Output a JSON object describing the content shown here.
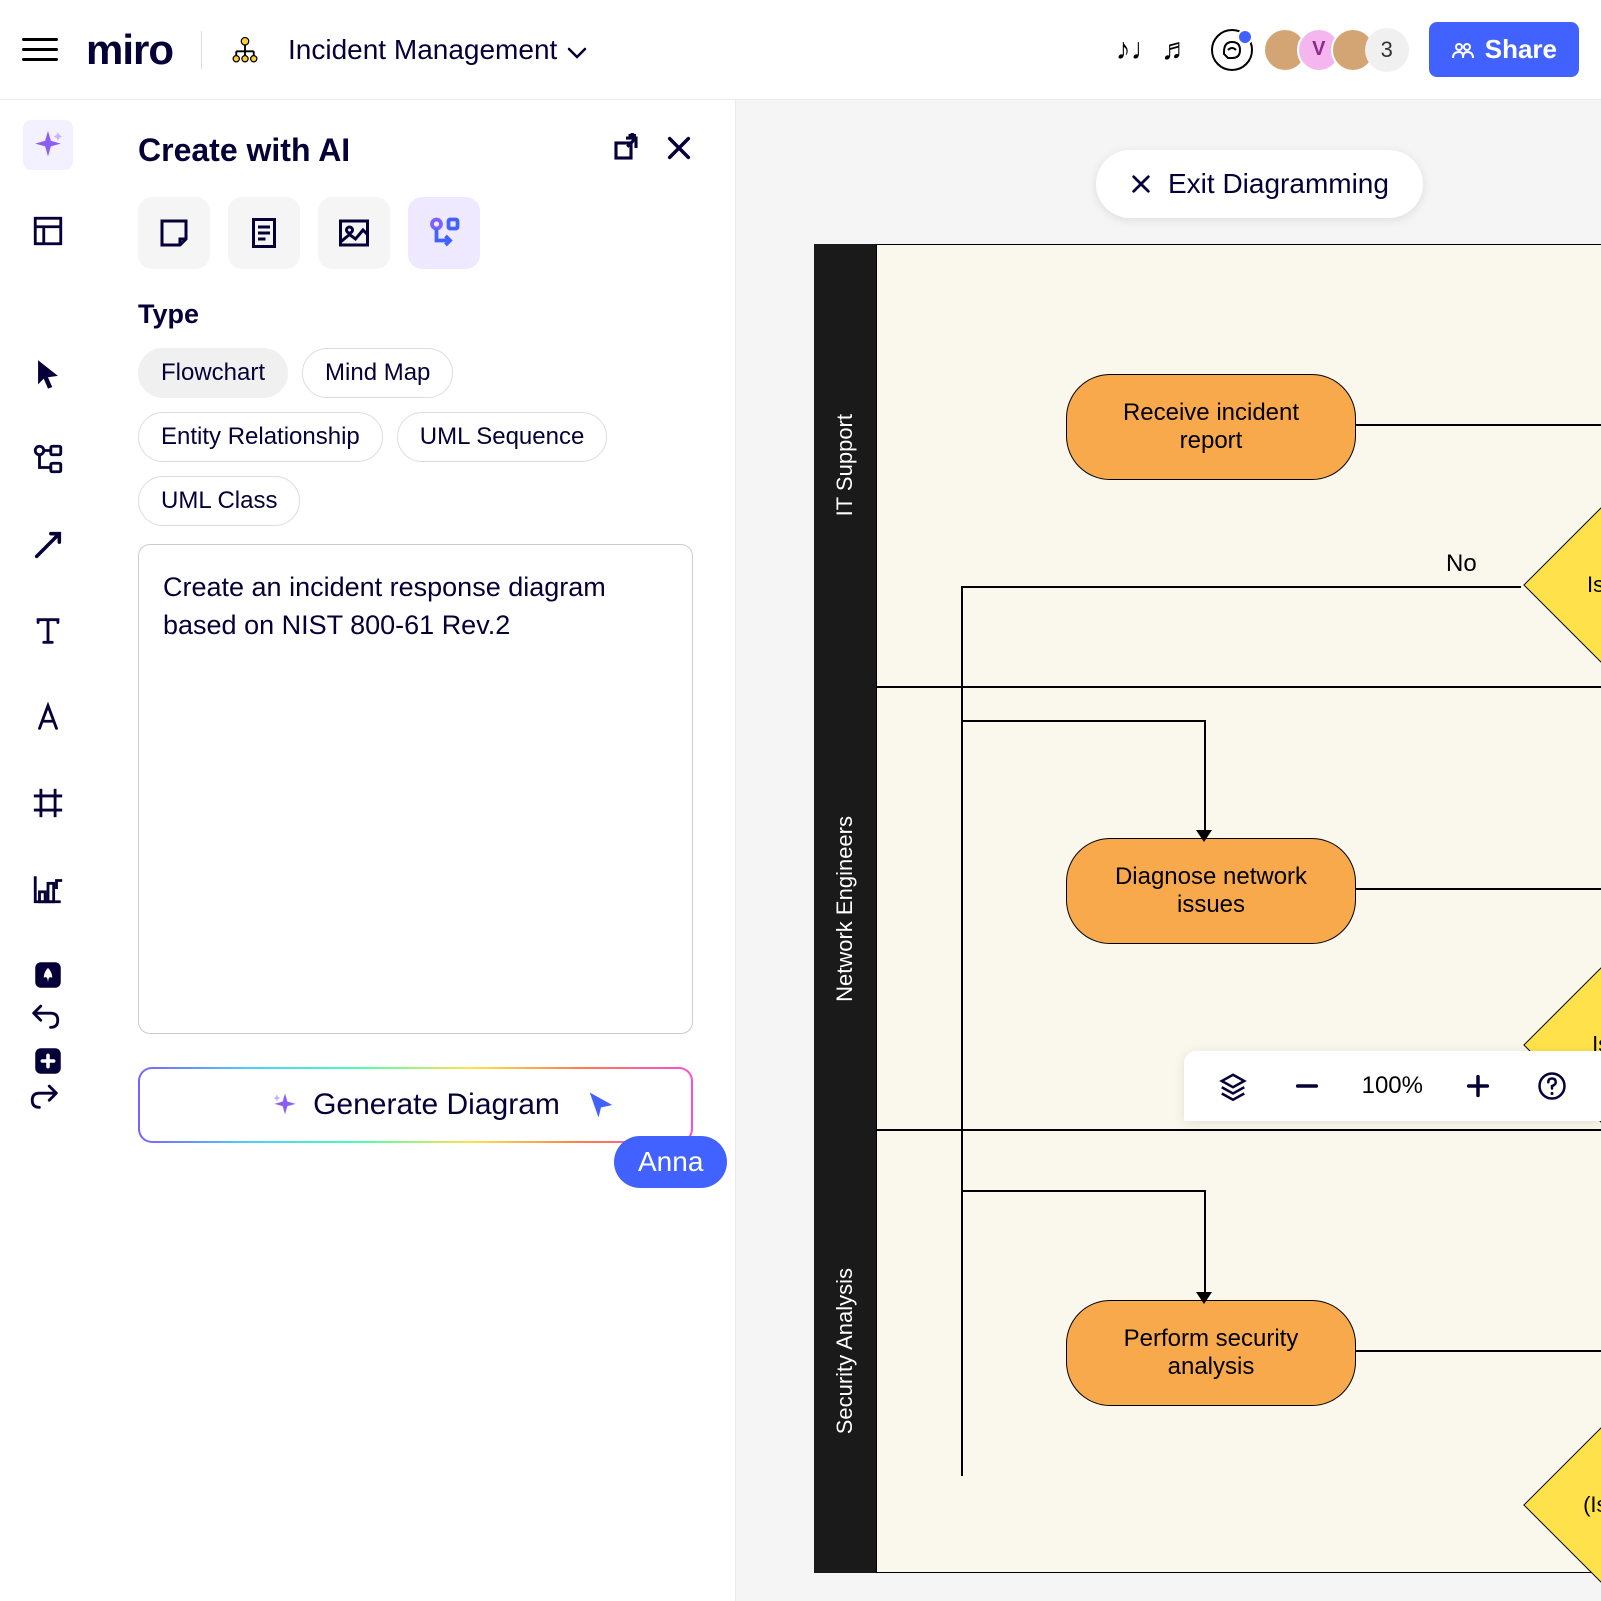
{
  "header": {
    "logo": "miro",
    "board_name": "Incident Management",
    "avatar_v_letter": "V",
    "avatar_count": "3",
    "share_label": "Share"
  },
  "ai_panel": {
    "title": "Create with AI",
    "type_label": "Type",
    "chips": [
      "Flowchart",
      "Mind Map",
      "Entity Relationship",
      "UML Sequence",
      "UML Class"
    ],
    "prompt_text": "Create an incident response diagram based on NIST 800-61 Rev.2",
    "generate_label": "Generate Diagram",
    "cursor_user": "Anna"
  },
  "canvas": {
    "exit_label": "Exit Diagramming",
    "lanes": [
      "IT Support",
      "Network Engineers",
      "Security Analysis"
    ],
    "nodes": {
      "receive": "Receive incident report",
      "diagnose": "Diagnose network issues",
      "perform": "Perform security analysis"
    },
    "decisions": {
      "is_it": "Is i",
      "is_paren": "(Is i",
      "is": "Is"
    },
    "edge_labels": {
      "no": "No"
    }
  },
  "bottom_bar": {
    "zoom": "100%"
  }
}
